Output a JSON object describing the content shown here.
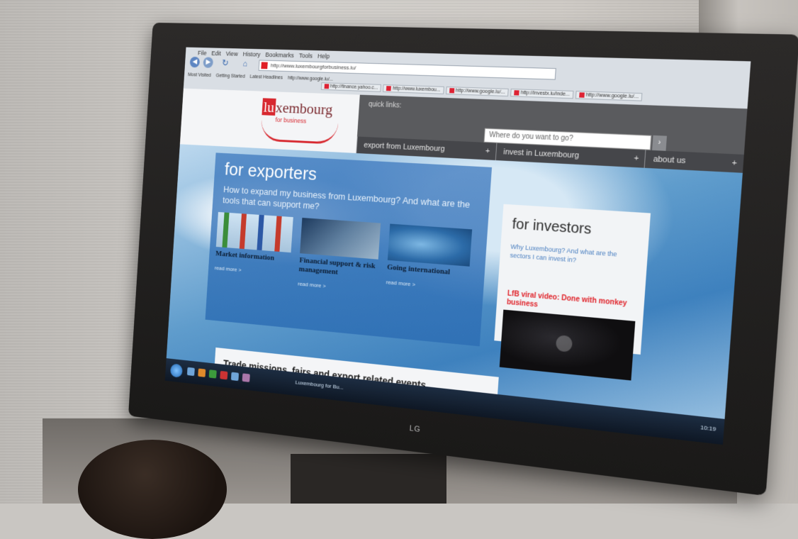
{
  "browser": {
    "menu": [
      "File",
      "Edit",
      "View",
      "History",
      "Bookmarks",
      "Tools",
      "Help"
    ],
    "address": "http://www.luxembourgforbusiness.lu/",
    "bookmarks": [
      "Most Visited",
      "Getting Started",
      "Latest Headlines",
      "http://www.google.lu/..."
    ],
    "tabs": [
      "http://finance.yahoo.c...",
      "http://www.luxembou...",
      "http://www.google.lu/...",
      "http://investx.lu/inde...",
      "http://www.google.lu/..."
    ]
  },
  "site": {
    "logo_main_prefix": "lu",
    "logo_main_rest": "xembourg",
    "logo_sub": "for business",
    "quick_links": "quick links:",
    "search_placeholder": "Where do you want to go?",
    "nav": [
      "export from Luxembourg",
      "invest in Luxembourg",
      "about us"
    ]
  },
  "exporters": {
    "title": "for exporters",
    "description": "How to expand my business from Luxembourg? And what are the tools that can support me?",
    "cards": [
      {
        "title": "Market information",
        "more": "read more >"
      },
      {
        "title": "Financial support & risk management",
        "more": "read more >"
      },
      {
        "title": "Going international",
        "more": "read more >"
      }
    ]
  },
  "investors": {
    "title": "for investors",
    "description": "Why Luxembourg? And what are the sectors I can invest in?",
    "video_title": "LfB viral video: Done with monkey business"
  },
  "trade": {
    "title": "Trade missions, fairs and export related events"
  },
  "taskbar": {
    "task": "Luxembourg for Bu...",
    "clock": "10:19"
  },
  "monitor": {
    "brand": "LG"
  }
}
